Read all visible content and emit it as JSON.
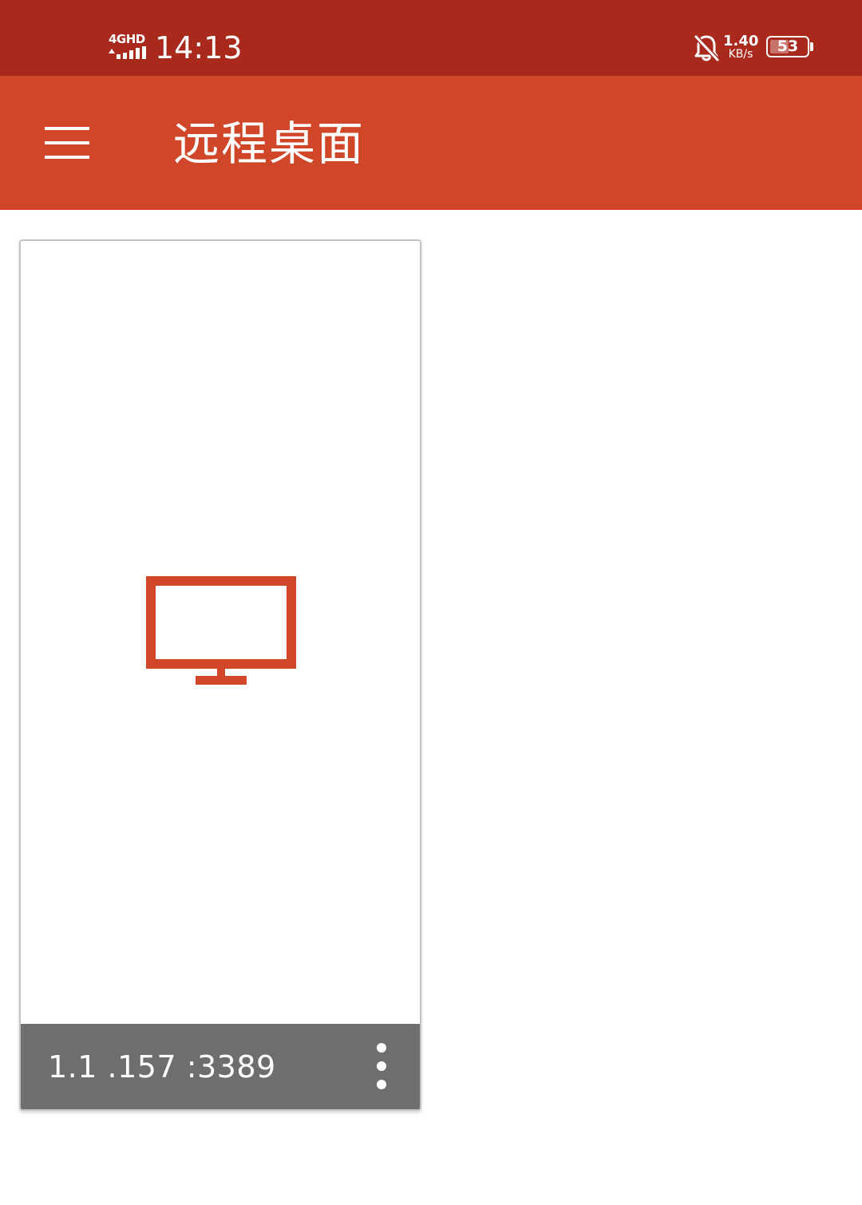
{
  "status_bar": {
    "network_type": "4GHD",
    "time": "14:13",
    "net_speed_value": "1.40",
    "net_speed_unit": "KB/s",
    "battery_level": "53",
    "battery_percent": 53,
    "icons": [
      "signal-icon",
      "bell-off-icon",
      "battery-icon"
    ]
  },
  "app_bar": {
    "title": "远程桌面",
    "menu_icon": "hamburger-menu-icon"
  },
  "connections": [
    {
      "host": "1.1 .157 :3389",
      "icon": "monitor-icon",
      "more_icon": "more-vert-icon"
    }
  ],
  "colors": {
    "status_bar": "#a9291d",
    "app_bar": "#d04628",
    "accent": "#d04628",
    "card_footer": "#6e6e6e"
  }
}
